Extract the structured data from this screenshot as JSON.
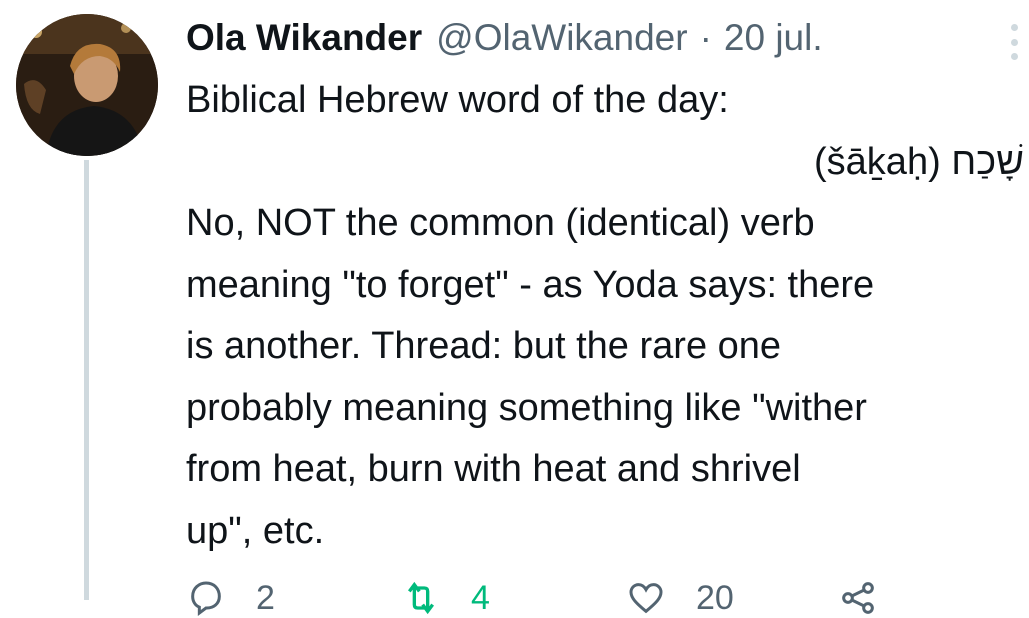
{
  "author": {
    "name": "Ola Wikander",
    "handle": "@OlaWikander",
    "separator": "·",
    "date": "20 jul."
  },
  "tweet": {
    "lines": [
      "Biblical Hebrew word of the day:",
      "(šāḵaḥ) שָׁכַח",
      "No, NOT the common (identical) verb",
      "meaning \"to forget\" - as Yoda says: there",
      "is another. Thread:  but the rare one",
      "probably meaning something like \"wither",
      "from heat, burn with heat and shrivel",
      "up\", etc."
    ]
  },
  "actions": {
    "reply": {
      "icon": "reply-icon",
      "count": "2"
    },
    "retweet": {
      "icon": "retweet-icon",
      "count": "4",
      "color": "#00ba7c"
    },
    "like": {
      "icon": "heart-icon",
      "count": "20"
    },
    "share": {
      "icon": "share-icon"
    }
  },
  "colors": {
    "text": "#0f1419",
    "secondary": "#536471",
    "thread_line": "#cfd9de",
    "retweeted": "#00ba7c"
  }
}
